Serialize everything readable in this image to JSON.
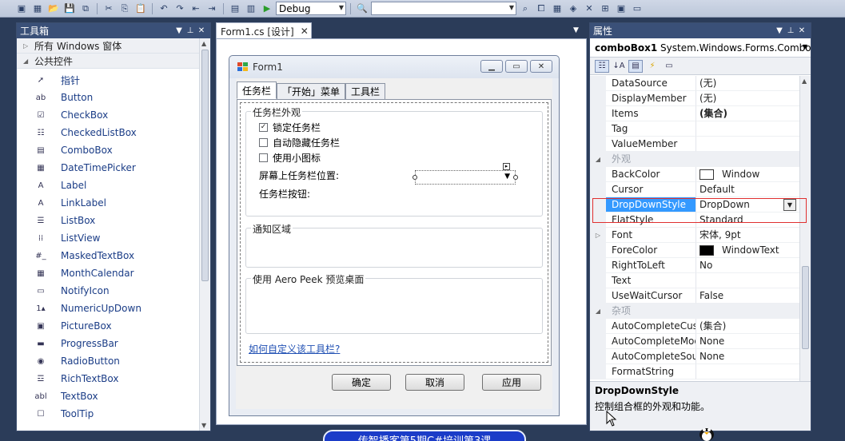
{
  "toolbar": {
    "config_value": "Debug",
    "search_value": ""
  },
  "toolbox": {
    "title": "工具箱",
    "groups": [
      {
        "label": "所有 Windows 窗体"
      },
      {
        "label": "公共控件"
      }
    ],
    "items": [
      {
        "label": "指针",
        "icon": "pointer-icon"
      },
      {
        "label": "Button",
        "icon": "button-icon"
      },
      {
        "label": "CheckBox",
        "icon": "checkbox-icon"
      },
      {
        "label": "CheckedListBox",
        "icon": "checkedlistbox-icon"
      },
      {
        "label": "ComboBox",
        "icon": "combobox-icon"
      },
      {
        "label": "DateTimePicker",
        "icon": "datetimepicker-icon"
      },
      {
        "label": "Label",
        "icon": "label-icon"
      },
      {
        "label": "LinkLabel",
        "icon": "linklabel-icon"
      },
      {
        "label": "ListBox",
        "icon": "listbox-icon"
      },
      {
        "label": "ListView",
        "icon": "listview-icon"
      },
      {
        "label": "MaskedTextBox",
        "icon": "maskedtextbox-icon"
      },
      {
        "label": "MonthCalendar",
        "icon": "monthcalendar-icon"
      },
      {
        "label": "NotifyIcon",
        "icon": "notifyicon-icon"
      },
      {
        "label": "NumericUpDown",
        "icon": "numericupdown-icon"
      },
      {
        "label": "PictureBox",
        "icon": "picturebox-icon"
      },
      {
        "label": "ProgressBar",
        "icon": "progressbar-icon"
      },
      {
        "label": "RadioButton",
        "icon": "radiobutton-icon"
      },
      {
        "label": "RichTextBox",
        "icon": "richtextbox-icon"
      },
      {
        "label": "TextBox",
        "icon": "textbox-icon"
      },
      {
        "label": "ToolTip",
        "icon": "tooltip-icon"
      }
    ]
  },
  "designer": {
    "tab_label": "Form1.cs [设计]",
    "form": {
      "title": "Form1",
      "tabs": [
        "任务栏",
        "「开始」菜单",
        "工具栏"
      ],
      "group1": {
        "title": "任务栏外观",
        "checks": [
          {
            "label": "锁定任务栏",
            "checked": "✓"
          },
          {
            "label": "自动隐藏任务栏",
            "checked": ""
          },
          {
            "label": "使用小图标",
            "checked": ""
          }
        ],
        "position_label": "屏幕上任务栏位置:",
        "buttons_label": "任务栏按钮:"
      },
      "group2_title": "通知区域",
      "group3_title": "使用 Aero Peek 预览桌面",
      "link_text": "如何自定义该工具栏?",
      "ok_label": "确定",
      "cancel_label": "取消",
      "apply_label": "应用"
    }
  },
  "properties": {
    "title": "属性",
    "object": "comboBox1",
    "object_type": "System.Windows.Forms.Combo",
    "rows": [
      {
        "name": "DataSource",
        "value": "(无)"
      },
      {
        "name": "DisplayMember",
        "value": "(无)"
      },
      {
        "name": "Items",
        "value": "(集合)"
      },
      {
        "name": "Tag",
        "value": ""
      },
      {
        "name": "ValueMember",
        "value": ""
      },
      {
        "name": "外观",
        "value": "",
        "category": true
      },
      {
        "name": "BackColor",
        "value": "Window",
        "swatch": "#ffffff"
      },
      {
        "name": "Cursor",
        "value": "Default"
      },
      {
        "name": "DropDownStyle",
        "value": "DropDown",
        "selected": true
      },
      {
        "name": "FlatStyle",
        "value": "Standard"
      },
      {
        "name": "Font",
        "value": "宋体, 9pt"
      },
      {
        "name": "ForeColor",
        "value": "WindowText",
        "swatch": "#000000"
      },
      {
        "name": "RightToLeft",
        "value": "No"
      },
      {
        "name": "Text",
        "value": ""
      },
      {
        "name": "UseWaitCursor",
        "value": "False"
      },
      {
        "name": "杂项",
        "value": "",
        "category": true
      },
      {
        "name": "AutoCompleteCust",
        "value": "(集合)"
      },
      {
        "name": "AutoCompleteMod",
        "value": "None"
      },
      {
        "name": "AutoCompleteSou",
        "value": "None"
      },
      {
        "name": "FormatString",
        "value": ""
      }
    ],
    "desc_title": "DropDownStyle",
    "desc_text": "控制组合框的外观和功能。"
  },
  "banner": {
    "text": "传智播客第5期C#培训第3课"
  },
  "colors": {
    "accent": "#3399ff",
    "highlight_box": "#e03030",
    "panel_title": "#3a5078"
  }
}
